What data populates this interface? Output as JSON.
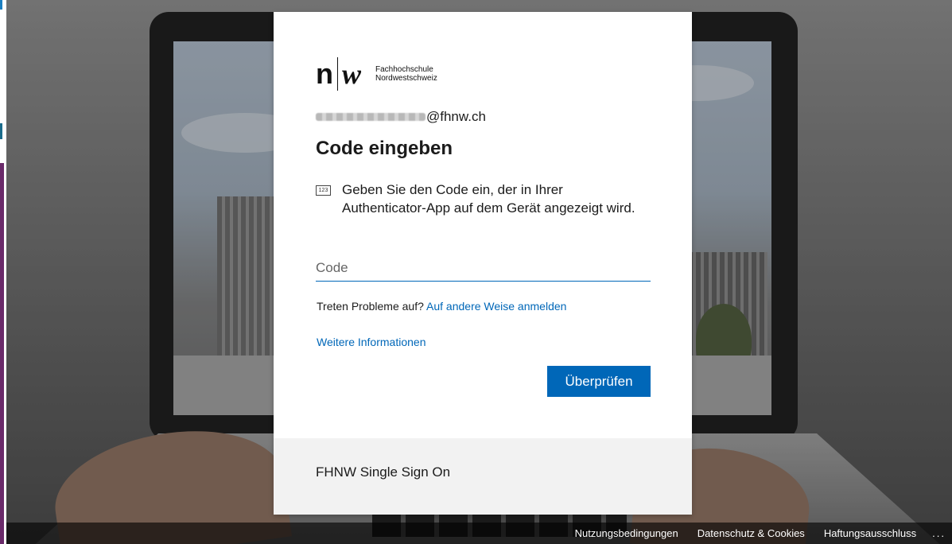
{
  "background": {
    "caption": ""
  },
  "logo": {
    "mark_left": "n",
    "mark_right": "w",
    "school_line1": "Fachhochschule",
    "school_line2": "Nordwestschweiz"
  },
  "identity": {
    "domain": "@fhnw.ch"
  },
  "title": "Code eingeben",
  "instruction": {
    "icon": "123-keypad-icon",
    "icon_label": "123",
    "text": "Geben Sie den Code ein, der in Ihrer Authenticator-App auf dem Gerät angezeigt wird."
  },
  "code_input": {
    "placeholder": "Code",
    "value": ""
  },
  "trouble": {
    "prefix": "Treten Probleme auf?",
    "link": "Auf andere Weise anmelden"
  },
  "more_info": "Weitere Informationen",
  "verify_button": "Überprüfen",
  "card_footer": "FHNW Single Sign On",
  "page_footer": {
    "terms": "Nutzungsbedingungen",
    "privacy": "Datenschutz & Cookies",
    "disclaimer": "Haftungsausschluss",
    "more": "..."
  },
  "colors": {
    "accent": "#0067b8",
    "footer_bg": "#f2f2f2"
  }
}
